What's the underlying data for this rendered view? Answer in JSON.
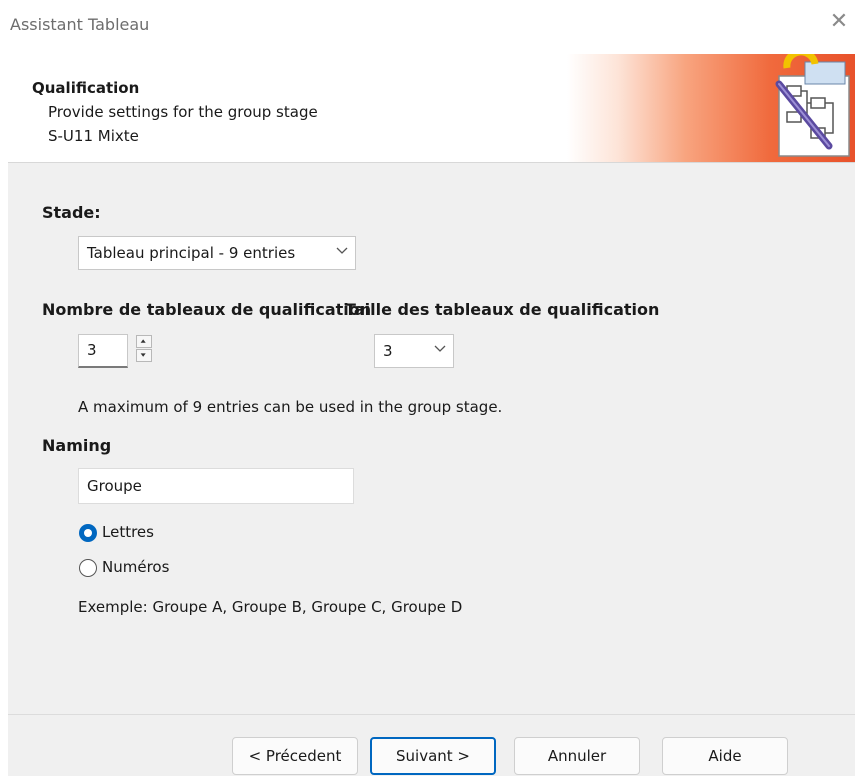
{
  "window": {
    "title": "Assistant Tableau"
  },
  "header": {
    "title": "Qualification",
    "subtitle": "Provide settings for the group stage",
    "event": "S-U11 Mixte"
  },
  "stage": {
    "label": "Stade:",
    "selected": "Tableau principal - 9 entries"
  },
  "qualification": {
    "count_label": "Nombre de tableaux de qualification",
    "count_value": "3",
    "size_label": "Taille des tableaux de qualification",
    "size_value": "3",
    "note": "A maximum of 9 entries can be used in the group stage."
  },
  "naming": {
    "label": "Naming",
    "value": "Groupe",
    "options": [
      {
        "label": "Lettres",
        "selected": true
      },
      {
        "label": "Numéros",
        "selected": false
      }
    ],
    "example": "Exemple: Groupe A, Groupe B, Groupe C, Groupe D"
  },
  "buttons": {
    "previous": "< Précedent",
    "next": "Suivant >",
    "cancel": "Annuler",
    "help": "Aide"
  },
  "colors": {
    "accent": "#0067c0",
    "header_gradient_end": "#e8522b"
  },
  "icons": {
    "close": "close-icon",
    "wizard_logo": "wizard-logo-icon",
    "dropdown": "chevron-down-icon",
    "spin_up": "arrow-up-icon",
    "spin_down": "arrow-down-icon"
  }
}
